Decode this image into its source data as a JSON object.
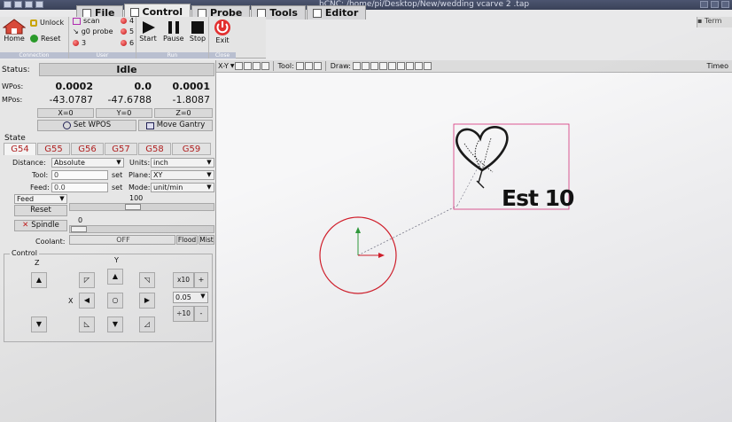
{
  "window": {
    "title": "bCNC: /home/pi/Desktop/New/wedding vcarve 2 .tap"
  },
  "menu": {
    "tabs": [
      {
        "label": "File"
      },
      {
        "label": "Control"
      },
      {
        "label": "Probe"
      },
      {
        "label": "Tools"
      },
      {
        "label": "Editor"
      }
    ],
    "terminal_label": "Term"
  },
  "toolbar": {
    "connection": {
      "group_label": "Connection",
      "home_label": "Home",
      "unlock_label": "Unlock",
      "reset_label": "Reset"
    },
    "user": {
      "group_label": "User",
      "scan_label": "scan",
      "g0probe_label": "g0 probe",
      "btn3_label": "3",
      "btn4_label": "4",
      "btn5_label": "5",
      "btn6_label": "6"
    },
    "run": {
      "group_label": "Run",
      "start_label": "Start",
      "pause_label": "Pause",
      "stop_label": "Stop"
    },
    "close": {
      "group_label": "Close",
      "exit_label": "Exit"
    }
  },
  "status": {
    "label": "Status:",
    "value": "Idle"
  },
  "position": {
    "wpos_label": "WPos:",
    "mpos_label": "MPos:",
    "wpos": [
      "0.0002",
      "0.0",
      "0.0001"
    ],
    "mpos": [
      "-43.0787",
      "-47.6788",
      "-1.8087"
    ],
    "zero_buttons": [
      "X=0",
      "Y=0",
      "Z=0"
    ],
    "set_wpos_label": "Set WPOS",
    "move_gantry_label": "Move Gantry"
  },
  "state": {
    "section_label": "State",
    "wcs_tabs": [
      "G54",
      "G55",
      "G56",
      "G57",
      "G58",
      "G59"
    ],
    "distance_label": "Distance:",
    "distance_value": "Absolute",
    "units_label": "Units:",
    "units_value": "inch",
    "tool_label": "Tool:",
    "tool_value": "0",
    "plane_label": "Plane:",
    "plane_value": "XY",
    "feed_label": "Feed:",
    "feed_value": "0.0",
    "mode_label": "Mode:",
    "mode_value": "unit/min",
    "set_label": "set",
    "feed_override_label": "Feed",
    "feed_override_value": "100",
    "reset_label": "Reset",
    "spindle_label": "Spindle",
    "spindle_value": "0",
    "coolant_label": "Coolant:",
    "coolant_value": "OFF",
    "flood_label": "Flood",
    "mist_label": "Mist"
  },
  "control": {
    "section_label": "Control",
    "z_label": "Z",
    "y_label": "Y",
    "x_label": "X",
    "step_values": [
      "x10",
      "0.05",
      "÷10"
    ],
    "plus_label": "+",
    "minus_label": "-"
  },
  "canvas": {
    "view_label": "X-Y",
    "tool_label": "Tool:",
    "draw_label": "Draw:",
    "right_label": "Timeo",
    "design_text": "Est 10"
  }
}
